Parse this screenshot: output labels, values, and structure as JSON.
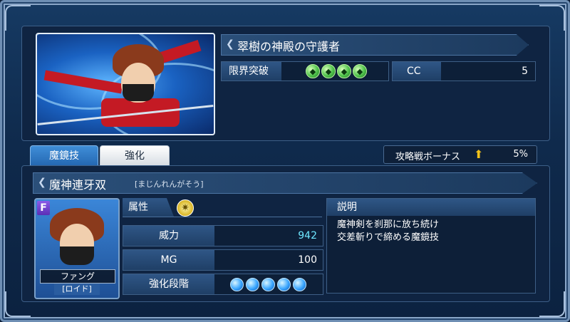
{
  "card": {
    "title": "翠樹の神殿の守護者",
    "limit_break_label": "限界突破",
    "limit_break_count": 4,
    "cc_label": "CC",
    "cc_value": "5"
  },
  "tabs": [
    {
      "label": "魔鏡技",
      "active": true
    },
    {
      "label": "強化",
      "active": false
    }
  ],
  "bonus": {
    "label": "攻略戦ボーナス",
    "value": "5%",
    "arrow_icon": "up-arrow-icon",
    "arrow_color": "#f2c21a"
  },
  "skill": {
    "name": "魔神連牙双",
    "reading": "[まじんれんがそう]"
  },
  "character": {
    "rarity": "F",
    "name": "ファング",
    "tag": "[ロイド]"
  },
  "attribute": {
    "label": "属性",
    "icon": "light-element-icon"
  },
  "stats": {
    "power_label": "威力",
    "power_value": "942",
    "mg_label": "MG",
    "mg_value": "100",
    "enhance_label": "強化段階",
    "enhance_level": 5
  },
  "description": {
    "header": "説明",
    "line1": "魔神剣を刹那に放ち続け",
    "line2": "交差斬りで締める魔鏡技"
  },
  "colors": {
    "accent_cyan": "#6ee7ff",
    "gem_green": "#4ec24a",
    "orb_blue": "#3aa6ff",
    "tab_active": "#2467b1"
  }
}
